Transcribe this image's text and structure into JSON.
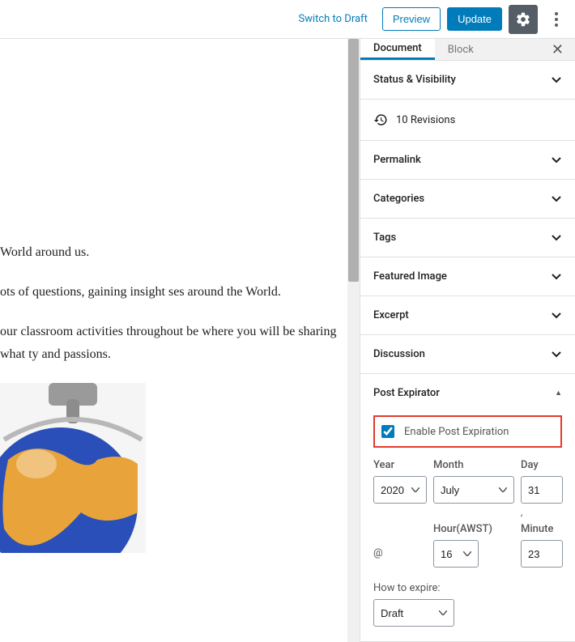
{
  "topbar": {
    "switch_draft": "Switch to Draft",
    "preview": "Preview",
    "update": "Update"
  },
  "tabs": {
    "document": "Document",
    "block": "Block"
  },
  "panels": {
    "status": "Status & Visibility",
    "revisions": "10 Revisions",
    "permalink": "Permalink",
    "categories": "Categories",
    "tags": "Tags",
    "featured_image": "Featured Image",
    "excerpt": "Excerpt",
    "discussion": "Discussion",
    "post_expirator": "Post Expirator"
  },
  "expirator": {
    "enable_label": "Enable Post Expiration",
    "enable_checked": true,
    "year_label": "Year",
    "year_value": "2020",
    "month_label": "Month",
    "month_value": "July",
    "day_label": "Day",
    "day_value": "31",
    "at_symbol": "@",
    "hour_label": "Hour(AWST)",
    "hour_value": "16",
    "minute_label": "Minute",
    "minute_value": "23",
    "comma": ",",
    "how_label": "How to expire:",
    "how_value": "Draft"
  },
  "editor": {
    "p1": "World around us.",
    "p2": "ots of questions, gaining insight ses around the World.",
    "p3": "our classroom activities throughout be where you will be sharing what ty and passions."
  }
}
